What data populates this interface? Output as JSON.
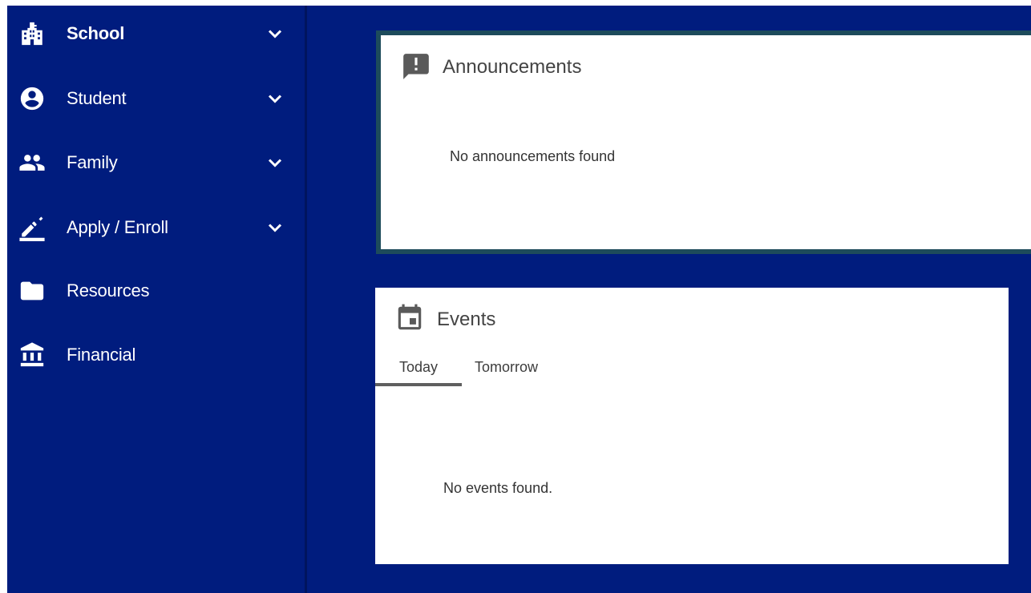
{
  "sidebar": {
    "items": [
      {
        "label": "School",
        "icon": "school-building-icon",
        "expandable": true,
        "bold": true
      },
      {
        "label": "Student",
        "icon": "account-circle-icon",
        "expandable": true,
        "bold": false
      },
      {
        "label": "Family",
        "icon": "people-icon",
        "expandable": true,
        "bold": false
      },
      {
        "label": "Apply / Enroll",
        "icon": "pencil-edit-icon",
        "expandable": true,
        "bold": false
      },
      {
        "label": "Resources",
        "icon": "folder-icon",
        "expandable": false,
        "bold": false
      },
      {
        "label": "Financial",
        "icon": "bank-icon",
        "expandable": false,
        "bold": false
      }
    ]
  },
  "announcements": {
    "title": "Announcements",
    "icon": "announcement-icon",
    "empty_message": "No announcements found"
  },
  "events": {
    "title": "Events",
    "icon": "calendar-icon",
    "tabs": [
      {
        "label": "Today",
        "active": true
      },
      {
        "label": "Tomorrow",
        "active": false
      }
    ],
    "empty_message": "No events found."
  },
  "colors": {
    "background": "#001c7e",
    "sidebar_divider": "#00145e",
    "card": "#ffffff",
    "announcement_border": "#1d4b5b",
    "text_dark": "#444444",
    "tab_indicator": "#5f5f5f"
  }
}
